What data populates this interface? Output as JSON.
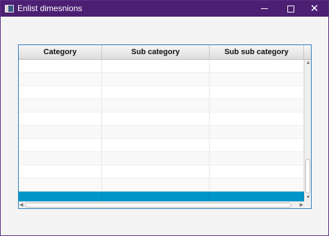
{
  "window": {
    "title": "Enlist dimesnions",
    "controls": {
      "minimize": "—",
      "maximize": "□",
      "close": "✕"
    },
    "icon": "app-window-icon"
  },
  "table": {
    "columns": [
      "Category",
      "Sub category",
      "Sub sub category"
    ],
    "rows": [
      {
        "category": "",
        "sub_category": "",
        "sub_sub_category": "",
        "selected": false
      },
      {
        "category": "",
        "sub_category": "",
        "sub_sub_category": "",
        "selected": false
      },
      {
        "category": "",
        "sub_category": "",
        "sub_sub_category": "",
        "selected": false
      },
      {
        "category": "",
        "sub_category": "",
        "sub_sub_category": "",
        "selected": false
      },
      {
        "category": "",
        "sub_category": "",
        "sub_sub_category": "",
        "selected": false
      },
      {
        "category": "",
        "sub_category": "",
        "sub_sub_category": "",
        "selected": false
      },
      {
        "category": "",
        "sub_category": "",
        "sub_sub_category": "",
        "selected": false
      },
      {
        "category": "",
        "sub_category": "",
        "sub_sub_category": "",
        "selected": false
      },
      {
        "category": "",
        "sub_category": "",
        "sub_sub_category": "",
        "selected": false
      },
      {
        "category": "",
        "sub_category": "",
        "sub_sub_category": "",
        "selected": false
      },
      {
        "category": "",
        "sub_category": "",
        "sub_sub_category": "",
        "selected": true
      }
    ],
    "selection_color": "#0096c9",
    "border_color": "#2f7fc0"
  },
  "theme": {
    "titlebar_color": "#4c1f73",
    "background": "#f4f4f4"
  }
}
